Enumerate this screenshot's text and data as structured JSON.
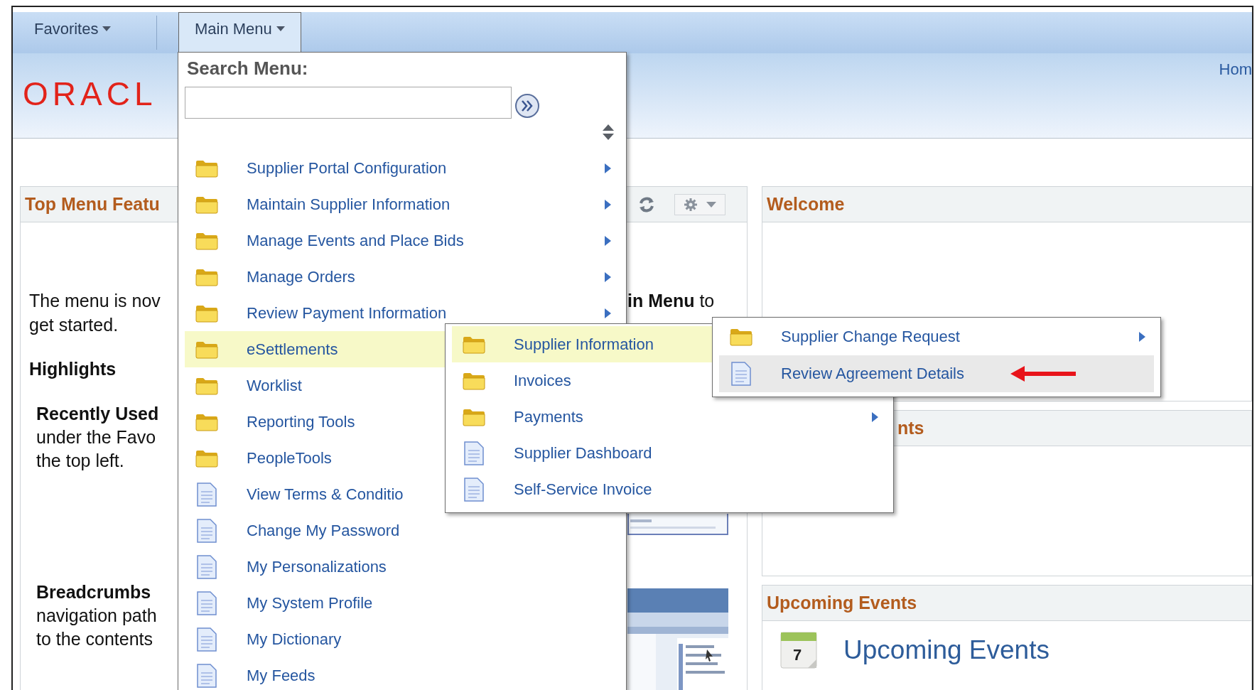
{
  "nav": [
    {
      "label": "Favorites",
      "selected": false
    },
    {
      "label": "Main Menu",
      "selected": true
    }
  ],
  "header": {
    "logo": "ORACL",
    "home_link": "Hom"
  },
  "left_panel": {
    "title": "Top Menu Featu",
    "intro_lines": [
      "The menu is nov",
      "get started."
    ],
    "highlights": "Highlights",
    "sections": [
      {
        "title": "Recently Used",
        "lines": [
          "under the Favo",
          "the top left."
        ]
      },
      {
        "title": "Breadcrumbs",
        "lines": [
          "navigation path",
          "to the contents"
        ]
      }
    ],
    "side_text": "**in Menu** to"
  },
  "right_panels": [
    {
      "title": "Welcome"
    },
    {
      "title": "nts"
    },
    {
      "title": "Upcoming Events",
      "body": {
        "calendar_day": "7",
        "heading": "Upcoming Events"
      }
    }
  ],
  "main_menu": {
    "search_label": "Search Menu:",
    "items": [
      {
        "label": "Supplier Portal Configuration",
        "kind": "folder",
        "has_submenu": true,
        "selected": false
      },
      {
        "label": "Maintain Supplier Information",
        "kind": "folder",
        "has_submenu": true,
        "selected": false
      },
      {
        "label": "Manage Events and Place Bids",
        "kind": "folder",
        "has_submenu": true,
        "selected": false
      },
      {
        "label": "Manage Orders",
        "kind": "folder",
        "has_submenu": true,
        "selected": false
      },
      {
        "label": "Review Payment Information",
        "kind": "folder",
        "has_submenu": true,
        "selected": false
      },
      {
        "label": "eSettlements",
        "kind": "folder",
        "has_submenu": false,
        "selected": true
      },
      {
        "label": "Worklist",
        "kind": "folder",
        "has_submenu": false,
        "selected": false
      },
      {
        "label": "Reporting Tools",
        "kind": "folder",
        "has_submenu": false,
        "selected": false
      },
      {
        "label": "PeopleTools",
        "kind": "folder",
        "has_submenu": false,
        "selected": false
      },
      {
        "label": "View Terms & Conditio",
        "kind": "page",
        "has_submenu": false,
        "selected": false
      },
      {
        "label": "Change My Password",
        "kind": "page",
        "has_submenu": false,
        "selected": false
      },
      {
        "label": "My Personalizations",
        "kind": "page",
        "has_submenu": false,
        "selected": false
      },
      {
        "label": "My System Profile",
        "kind": "page",
        "has_submenu": false,
        "selected": false
      },
      {
        "label": "My Dictionary",
        "kind": "page",
        "has_submenu": false,
        "selected": false
      },
      {
        "label": "My Feeds",
        "kind": "page",
        "has_submenu": false,
        "selected": false
      }
    ]
  },
  "submenus": [
    {
      "items": [
        {
          "label": "Supplier Information",
          "kind": "folder",
          "has_submenu": false,
          "selected": true
        },
        {
          "label": "Invoices",
          "kind": "folder",
          "has_submenu": false,
          "selected": false
        },
        {
          "label": "Payments",
          "kind": "folder",
          "has_submenu": true,
          "selected": false
        },
        {
          "label": "Supplier Dashboard",
          "kind": "page",
          "has_submenu": false,
          "selected": false
        },
        {
          "label": "Self-Service Invoice",
          "kind": "page",
          "has_submenu": false,
          "selected": false
        }
      ]
    },
    {
      "items": [
        {
          "label": "Supplier Change Request",
          "kind": "folder",
          "has_submenu": true,
          "selected": false,
          "hovered": false
        },
        {
          "label": "Review Agreement Details",
          "kind": "page",
          "has_submenu": false,
          "selected": false,
          "hovered": true
        }
      ]
    }
  ]
}
